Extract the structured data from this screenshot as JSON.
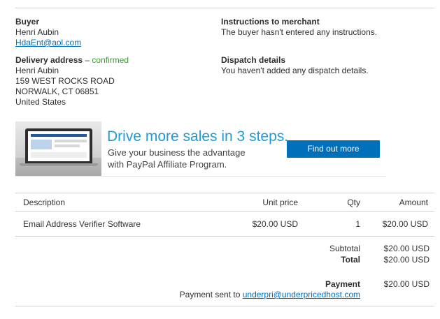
{
  "buyer": {
    "heading": "Buyer",
    "name": "Henri Aubin",
    "email": "HdaEnt@aol.com"
  },
  "delivery": {
    "heading": "Delivery address",
    "separator": " – ",
    "status": "confirmed",
    "lines": [
      "Henri Aubin",
      "159 WEST ROCKS ROAD",
      "NORWALK, CT 06851",
      "United States"
    ]
  },
  "instructions": {
    "heading": "Instructions to merchant",
    "text": "The buyer hasn't entered any instructions."
  },
  "dispatch": {
    "heading": "Dispatch details",
    "text": "You haven't added any dispatch details."
  },
  "banner": {
    "title": "Drive more sales in 3 steps.",
    "subtitle_line1": "Give your business the advantage",
    "subtitle_line2": "with PayPal Affiliate Program.",
    "button_label": "Find out more",
    "accent_color": "#1e9cd7",
    "button_color": "#0070ba"
  },
  "items_table": {
    "headers": {
      "description": "Description",
      "unit_price": "Unit price",
      "qty": "Qty",
      "amount": "Amount"
    },
    "rows": [
      {
        "description": "Email Address Verifier Software",
        "unit_price": "$20.00 USD",
        "qty": "1",
        "amount": "$20.00 USD"
      }
    ]
  },
  "totals": {
    "subtotal_label": "Subtotal",
    "subtotal_value": "$20.00 USD",
    "total_label": "Total",
    "total_value": "$20.00 USD"
  },
  "payment": {
    "label": "Payment",
    "value": "$20.00 USD",
    "sent_to_prefix": "Payment sent to ",
    "sent_to_email": "underpri@underpricedhost.com"
  }
}
